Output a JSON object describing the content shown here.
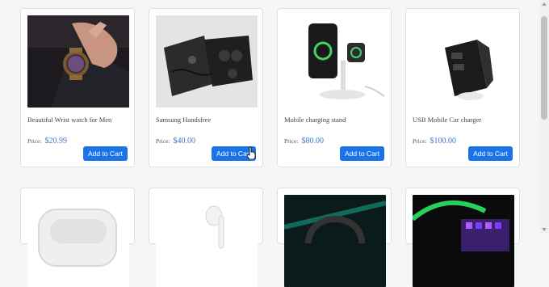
{
  "products": [
    {
      "name": "Beautiful Wrist watch for Men",
      "price_label": "Price:",
      "price": "$20.99",
      "button": "Add to Cart"
    },
    {
      "name": "Samsung Handsfree",
      "price_label": "Price:",
      "price": "$40.00",
      "button": "Add to Cart"
    },
    {
      "name": "Mobile charging stand",
      "price_label": "Price:",
      "price": "$80.00",
      "button": "Add to Cart"
    },
    {
      "name": "USB Mobile Car charger",
      "price_label": "Price:",
      "price": "$100.00",
      "button": "Add to Cart"
    }
  ],
  "colors": {
    "accent": "#1a73e8",
    "price": "#3a78c3"
  }
}
